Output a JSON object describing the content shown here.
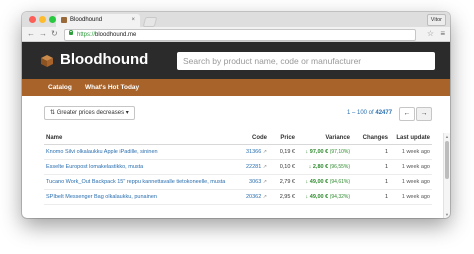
{
  "browser": {
    "tab_title": "Bloodhound",
    "tab_close": "×",
    "user_label": "Vitor",
    "url_scheme": "https://",
    "url_host": "bloodhound.me",
    "back_glyph": "←",
    "forward_glyph": "→",
    "reload_glyph": "↻",
    "star_glyph": "☆",
    "menu_glyph": "≡"
  },
  "site": {
    "logo_text": "Bloodhound",
    "search_placeholder": "Search by product name, code or manufacturer",
    "brand_color": "#a8632a"
  },
  "nav": {
    "items": [
      {
        "label": "Catalog"
      },
      {
        "label": "What's Hot Today"
      }
    ]
  },
  "controls": {
    "sort_label": "Greater prices decreases",
    "sort_icon": "sort-amount-icon",
    "pager_prefix": "1 – 100 of ",
    "pager_total": "42477",
    "prev_glyph": "←",
    "next_glyph": "→"
  },
  "table": {
    "headers": {
      "name": "Name",
      "code": "Code",
      "price": "Price",
      "variance": "Variance",
      "changes": "Changes",
      "last_update": "Last update"
    },
    "rows": [
      {
        "name": "Knomo Silvi olkalaukku Apple iPadille, sininen",
        "code": "31366",
        "price": "0,19 €",
        "variance": "↓ 97,00 €",
        "pct": "(97,10%)",
        "changes": "1",
        "last_update": "1 week ago"
      },
      {
        "name": "Esselte Europost lomakelastikko, musta",
        "code": "22281",
        "price": "0,10 €",
        "variance": "↓ 2,80 €",
        "pct": "(96,55%)",
        "changes": "1",
        "last_update": "1 week ago"
      },
      {
        "name": "Tucano Work_Out Backpack 15\" reppu kannettavalle tietokoneelle, musta",
        "code": "3063",
        "price": "2,79 €",
        "variance": "↓ 49,00 €",
        "pct": "(94,61%)",
        "changes": "1",
        "last_update": "1 week ago"
      },
      {
        "name": "SPIbelt Messenger Bag olkalaukku, punainen",
        "code": "20362",
        "price": "2,95 €",
        "variance": "↓ 49,00 €",
        "pct": "(94,32%)",
        "changes": "1",
        "last_update": "1 week ago"
      }
    ]
  }
}
